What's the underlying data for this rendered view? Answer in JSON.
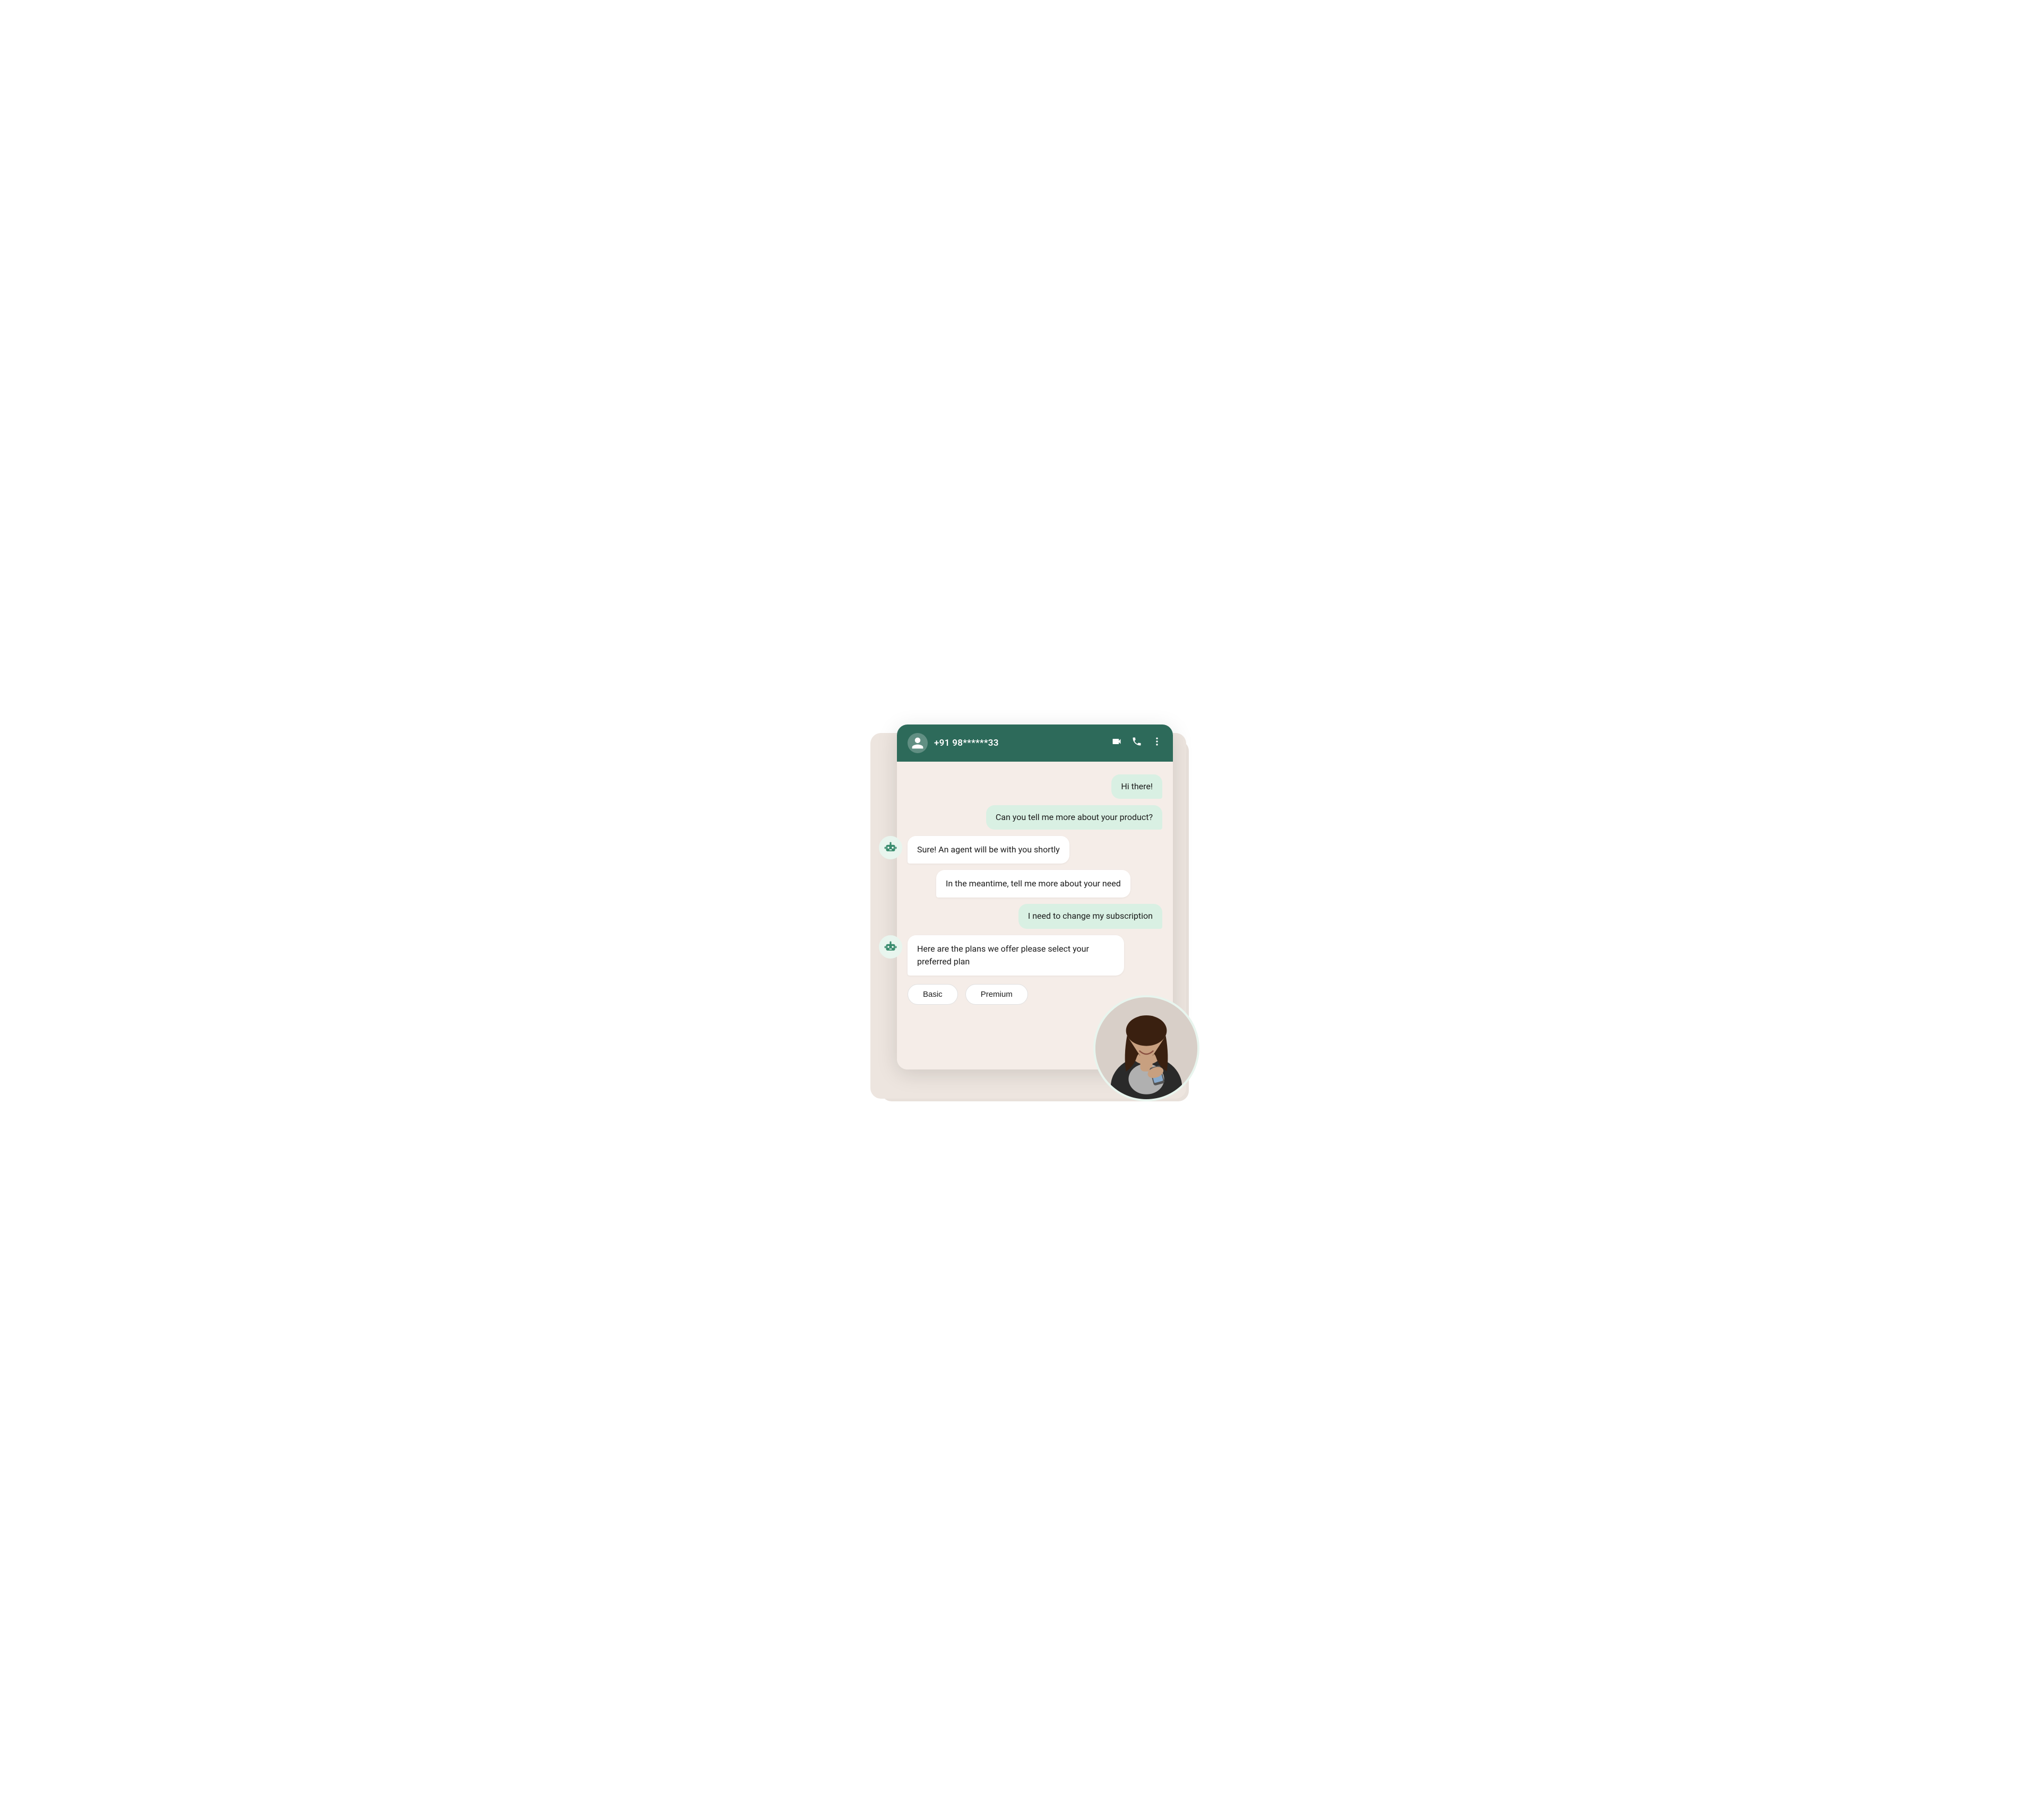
{
  "header": {
    "contact": "+91 98******33",
    "avatar_icon": "👤"
  },
  "messages": [
    {
      "id": "msg-1",
      "type": "outgoing",
      "text": "Hi there!"
    },
    {
      "id": "msg-2",
      "type": "outgoing",
      "text": "Can you tell me more about your product?"
    },
    {
      "id": "msg-3",
      "type": "incoming",
      "text": "Sure! An agent will be with you shortly"
    },
    {
      "id": "msg-4",
      "type": "incoming",
      "text": "In the meantime, tell me more about your need"
    },
    {
      "id": "msg-5",
      "type": "outgoing",
      "text": "I need to change my subscription"
    },
    {
      "id": "msg-6",
      "type": "incoming",
      "text": "Here are the plans we offer please select your preferred plan"
    }
  ],
  "quick_replies": [
    {
      "id": "qr-1",
      "label": "Basic"
    },
    {
      "id": "qr-2",
      "label": "Premium"
    }
  ],
  "icons": {
    "video": "📹",
    "phone": "📞",
    "more": "⋮"
  }
}
